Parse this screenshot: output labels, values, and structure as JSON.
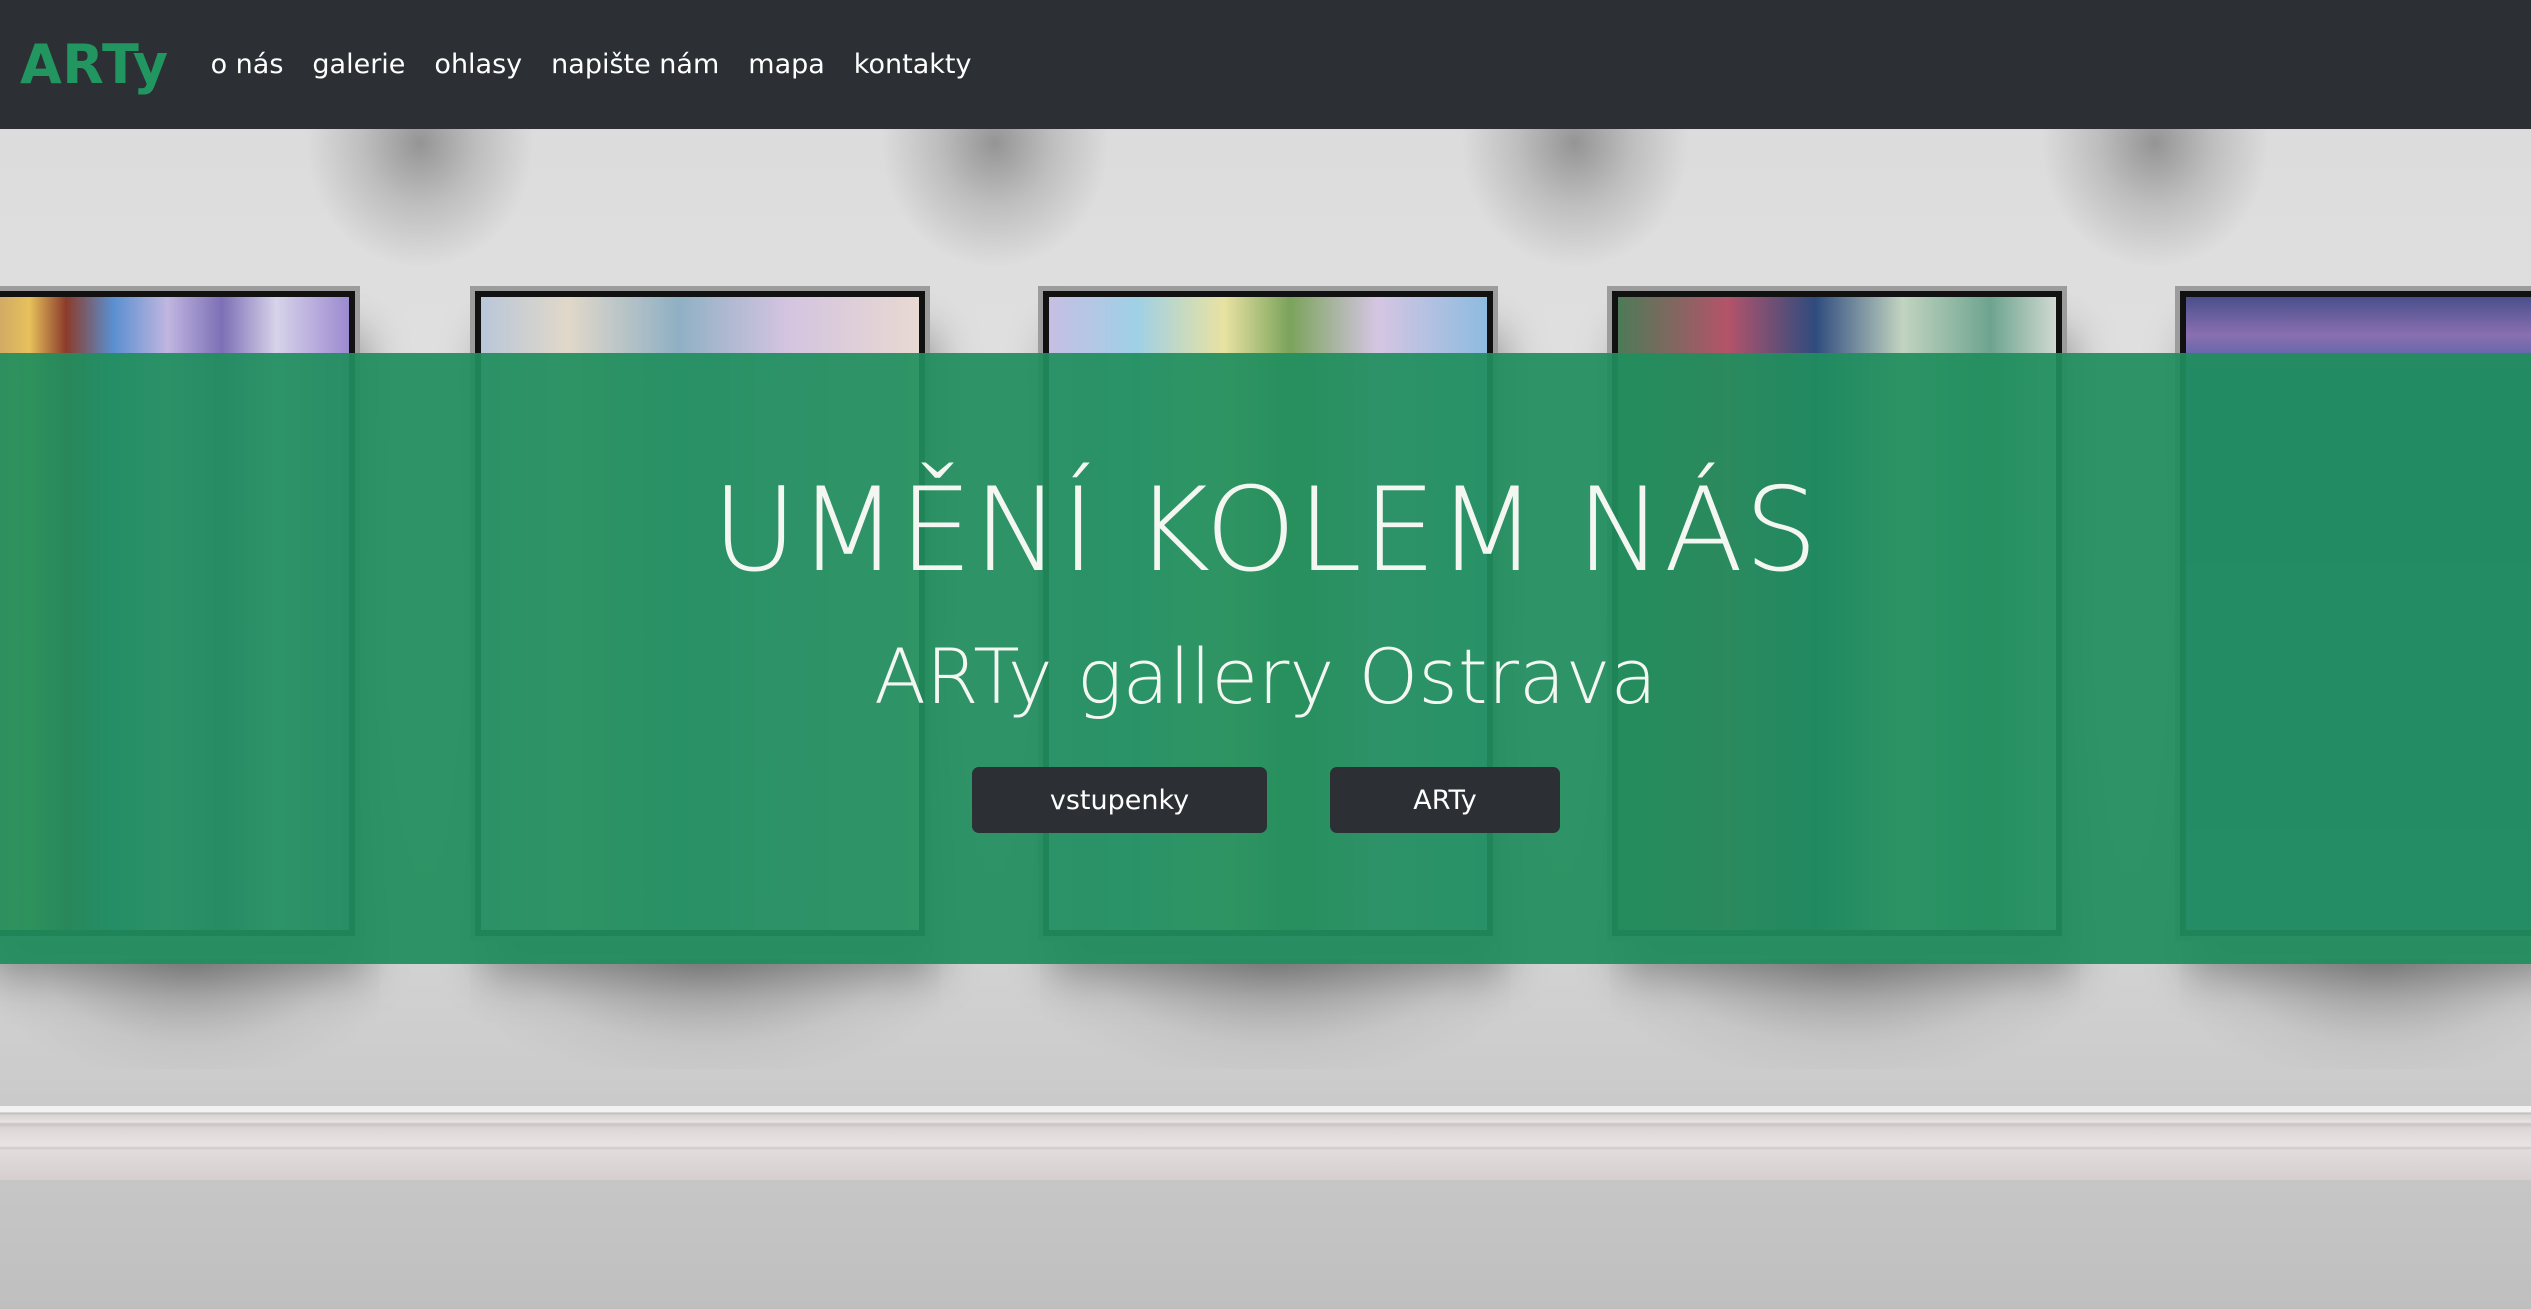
{
  "navbar": {
    "brand": "ARTy",
    "items": [
      {
        "label": "o nás"
      },
      {
        "label": "galerie"
      },
      {
        "label": "ohlasy"
      },
      {
        "label": "napište nám"
      },
      {
        "label": "mapa"
      },
      {
        "label": "kontakty"
      }
    ]
  },
  "hero": {
    "title": "UMĚNÍ KOLEM NÁS",
    "subtitle": "ARTy gallery Ostrava",
    "buttons": {
      "tickets_label": "vstupenky",
      "arty_label": "ARTy"
    }
  },
  "colors": {
    "navbar_bg": "#2c2f33",
    "brand": "#229660",
    "hero_band": "#208e5e",
    "button_bg": "#2c2f33",
    "text_light": "#f4f6f2"
  }
}
